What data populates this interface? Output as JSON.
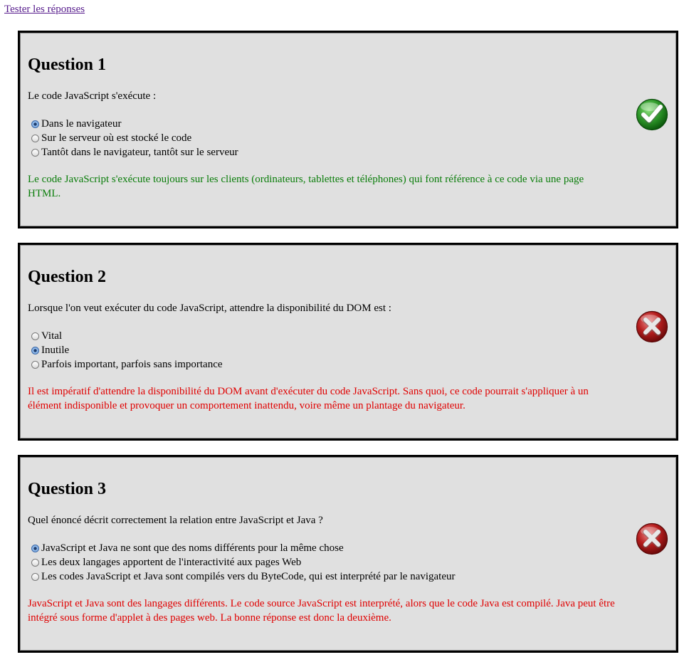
{
  "header": {
    "test_link": "Tester les réponses"
  },
  "colors": {
    "correct": "#0a7d0a",
    "incorrect": "#e00000",
    "link": "#551a8b"
  },
  "questions": [
    {
      "title": "Question 1",
      "prompt": "Le code JavaScript s'exécute :",
      "options": [
        {
          "label": "Dans le navigateur",
          "selected": true
        },
        {
          "label": "Sur le serveur où est stocké le code",
          "selected": false
        },
        {
          "label": "Tantôt dans le navigateur, tantôt sur le serveur",
          "selected": false
        }
      ],
      "result": "correct",
      "result_icon": "check-icon",
      "explanation": "Le code JavaScript s'exécute toujours sur les clients (ordinateurs, tablettes et téléphones) qui font référence à ce code via une page HTML."
    },
    {
      "title": "Question 2",
      "prompt": "Lorsque l'on veut exécuter du code JavaScript, attendre la disponibilité du DOM est :",
      "options": [
        {
          "label": "Vital",
          "selected": false
        },
        {
          "label": "Inutile",
          "selected": true
        },
        {
          "label": "Parfois important, parfois sans importance",
          "selected": false
        }
      ],
      "result": "incorrect",
      "result_icon": "cross-icon",
      "explanation": "Il est impératif d'attendre la disponibilité du DOM avant d'exécuter du code JavaScript. Sans quoi, ce code pourrait s'appliquer à un élément indisponible et provoquer un comportement inattendu, voire même un plantage du navigateur."
    },
    {
      "title": "Question 3",
      "prompt": "Quel énoncé décrit correctement la relation entre JavaScript et Java ?",
      "options": [
        {
          "label": "JavaScript et Java ne sont que des noms différents pour la même chose",
          "selected": true
        },
        {
          "label": "Les deux langages apportent de l'interactivité aux pages Web",
          "selected": false
        },
        {
          "label": "Les codes JavaScript et Java sont compilés vers du ByteCode, qui est interprété par le navigateur",
          "selected": false
        }
      ],
      "result": "incorrect",
      "result_icon": "cross-icon",
      "explanation": "JavaScript et Java sont des langages différents. Le code source JavaScript est interprété, alors que le code Java est compilé. Java peut être intégré sous forme d'applet à des pages web. La bonne réponse est donc la deuxième."
    }
  ]
}
